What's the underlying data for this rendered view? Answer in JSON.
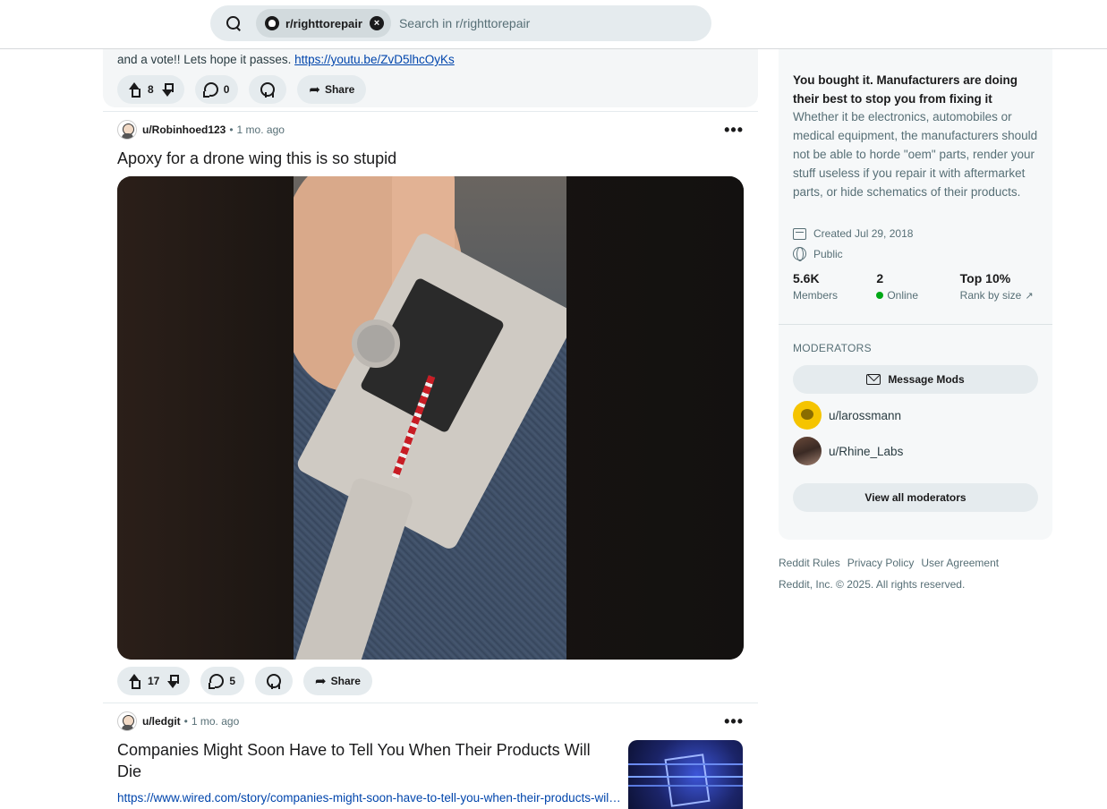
{
  "search": {
    "community_chip": "r/righttorepair",
    "placeholder": "Search in r/righttorepair",
    "clear_icon": "×"
  },
  "posts": [
    {
      "text_prefix": "and a vote!! Lets hope it passes. ",
      "link": "https://youtu.be/ZvD5lhcOyKs",
      "votes": "8",
      "comments": "0",
      "share_label": "Share"
    },
    {
      "author": "u/Robinhoed123",
      "age": "1 mo. ago",
      "title": "Apoxy for a drone wing this is so stupid",
      "votes": "17",
      "comments": "5",
      "share_label": "Share"
    },
    {
      "author": "u/ledgit",
      "age": "1 mo. ago",
      "title": "Companies Might Soon Have to Tell You When Their Products Will Die",
      "link": "https://www.wired.com/story/companies-might-soon-have-to-tell-you-when-their-products-will-die/"
    }
  ],
  "sidebar": {
    "title": "You bought it. Manufacturers are doing their best to stop you from fixing it",
    "description": "Whether it be electronics, automobiles or medical equipment, the manufacturers should not be able to horde \"oem\" parts, render your stuff useless if you repair it with aftermarket parts, or hide schematics of their products.",
    "created": "Created Jul 29, 2018",
    "visibility": "Public",
    "stats": [
      {
        "value": "5.6K",
        "label": "Members"
      },
      {
        "value": "2",
        "label": "Online"
      },
      {
        "value": "Top 10%",
        "label": "Rank by size"
      }
    ],
    "moderators_heading": "MODERATORS",
    "message_mods": "Message Mods",
    "moderators": [
      "u/larossmann",
      "u/Rhine_Labs"
    ],
    "view_all": "View all moderators"
  },
  "footer": {
    "links": [
      "Reddit Rules",
      "Privacy Policy",
      "User Agreement"
    ],
    "copyright": "Reddit, Inc. © 2025. All rights reserved."
  },
  "colors": {
    "accent_link": "#0045ac",
    "online": "#01a816",
    "pill_bg": "#e5ebee"
  },
  "dot_separator": "•",
  "more_icon": "•••",
  "share_glyph": "➦",
  "external_link_glyph": "↗"
}
